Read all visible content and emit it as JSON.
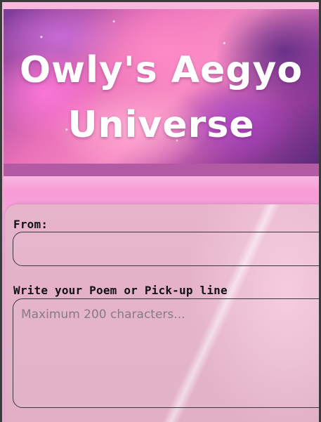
{
  "banner": {
    "title_line1": "Owly's Aegyo",
    "title_line2": "Universe"
  },
  "form": {
    "from_label": "From:",
    "from_value": "",
    "poem_label": "Write your Poem or Pick-up line",
    "poem_placeholder": "Maximum 200 characters..."
  },
  "colors": {
    "banner_strip": "#b35aa5",
    "page_pink": "#f3a6d4",
    "card_pink": "#e3b0c8",
    "label_text": "#121212",
    "placeholder_text": "#8a7a82"
  }
}
